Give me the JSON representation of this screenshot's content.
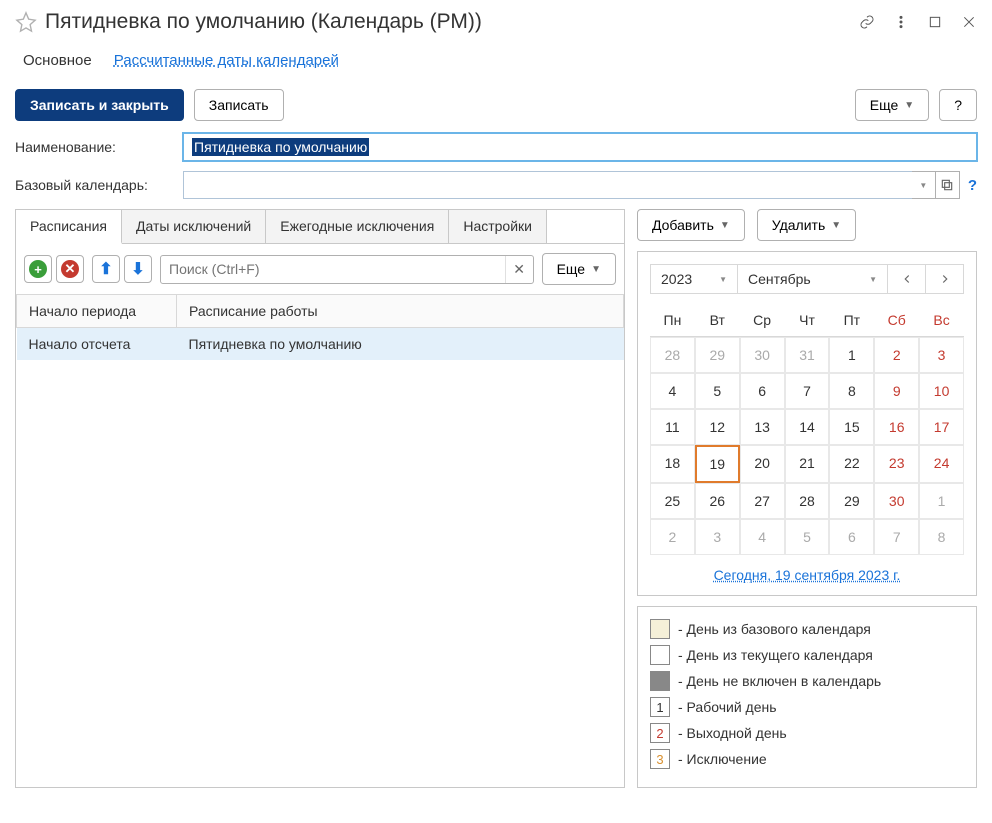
{
  "title": "Пятидневка по умолчанию (Календарь (РМ))",
  "nav": {
    "main": "Основное",
    "calc": "Рассчитанные даты календарей"
  },
  "toolbar": {
    "save_close": "Записать и закрыть",
    "save": "Записать",
    "more": "Еще",
    "help": "?"
  },
  "form": {
    "name_label": "Наименование:",
    "name_value": "Пятидневка по умолчанию",
    "base_label": "Базовый календарь:",
    "base_value": ""
  },
  "tabs": {
    "schedules": "Расписания",
    "exception_dates": "Даты исключений",
    "yearly_exceptions": "Ежегодные исключения",
    "settings": "Настройки"
  },
  "sub": {
    "search_placeholder": "Поиск (Ctrl+F)",
    "more": "Еще"
  },
  "table": {
    "col_start": "Начало периода",
    "col_schedule": "Расписание работы",
    "row1_start": "Начало отсчета",
    "row1_schedule": "Пятидневка по умолчанию"
  },
  "right_toolbar": {
    "add": "Добавить",
    "delete": "Удалить"
  },
  "calendar": {
    "year": "2023",
    "month": "Сентябрь",
    "dow": [
      "Пн",
      "Вт",
      "Ср",
      "Чт",
      "Пт",
      "Сб",
      "Вс"
    ],
    "today_link": "Сегодня, 19 сентября 2023 г.",
    "weeks": [
      [
        {
          "d": "28",
          "o": true
        },
        {
          "d": "29",
          "o": true
        },
        {
          "d": "30",
          "o": true
        },
        {
          "d": "31",
          "o": true
        },
        {
          "d": "1"
        },
        {
          "d": "2",
          "w": true
        },
        {
          "d": "3",
          "w": true
        }
      ],
      [
        {
          "d": "4"
        },
        {
          "d": "5"
        },
        {
          "d": "6"
        },
        {
          "d": "7"
        },
        {
          "d": "8"
        },
        {
          "d": "9",
          "w": true
        },
        {
          "d": "10",
          "w": true
        }
      ],
      [
        {
          "d": "11"
        },
        {
          "d": "12"
        },
        {
          "d": "13"
        },
        {
          "d": "14"
        },
        {
          "d": "15"
        },
        {
          "d": "16",
          "w": true
        },
        {
          "d": "17",
          "w": true
        }
      ],
      [
        {
          "d": "18"
        },
        {
          "d": "19",
          "t": true
        },
        {
          "d": "20"
        },
        {
          "d": "21"
        },
        {
          "d": "22"
        },
        {
          "d": "23",
          "w": true
        },
        {
          "d": "24",
          "w": true
        }
      ],
      [
        {
          "d": "25"
        },
        {
          "d": "26"
        },
        {
          "d": "27"
        },
        {
          "d": "28"
        },
        {
          "d": "29"
        },
        {
          "d": "30",
          "w": true
        },
        {
          "d": "1",
          "o": true
        }
      ],
      [
        {
          "d": "2",
          "o": true
        },
        {
          "d": "3",
          "o": true
        },
        {
          "d": "4",
          "o": true
        },
        {
          "d": "5",
          "o": true
        },
        {
          "d": "6",
          "o": true
        },
        {
          "d": "7",
          "o": true
        },
        {
          "d": "8",
          "o": true
        }
      ]
    ]
  },
  "legend": {
    "base": " - День из базового календаря",
    "current": " - День из текущего календаря",
    "excluded": " - День не включен в календарь",
    "work": " - Рабочий день",
    "holiday": " - Выходной день",
    "exception": " - Исключение",
    "n1": "1",
    "n2": "2",
    "n3": "3"
  }
}
